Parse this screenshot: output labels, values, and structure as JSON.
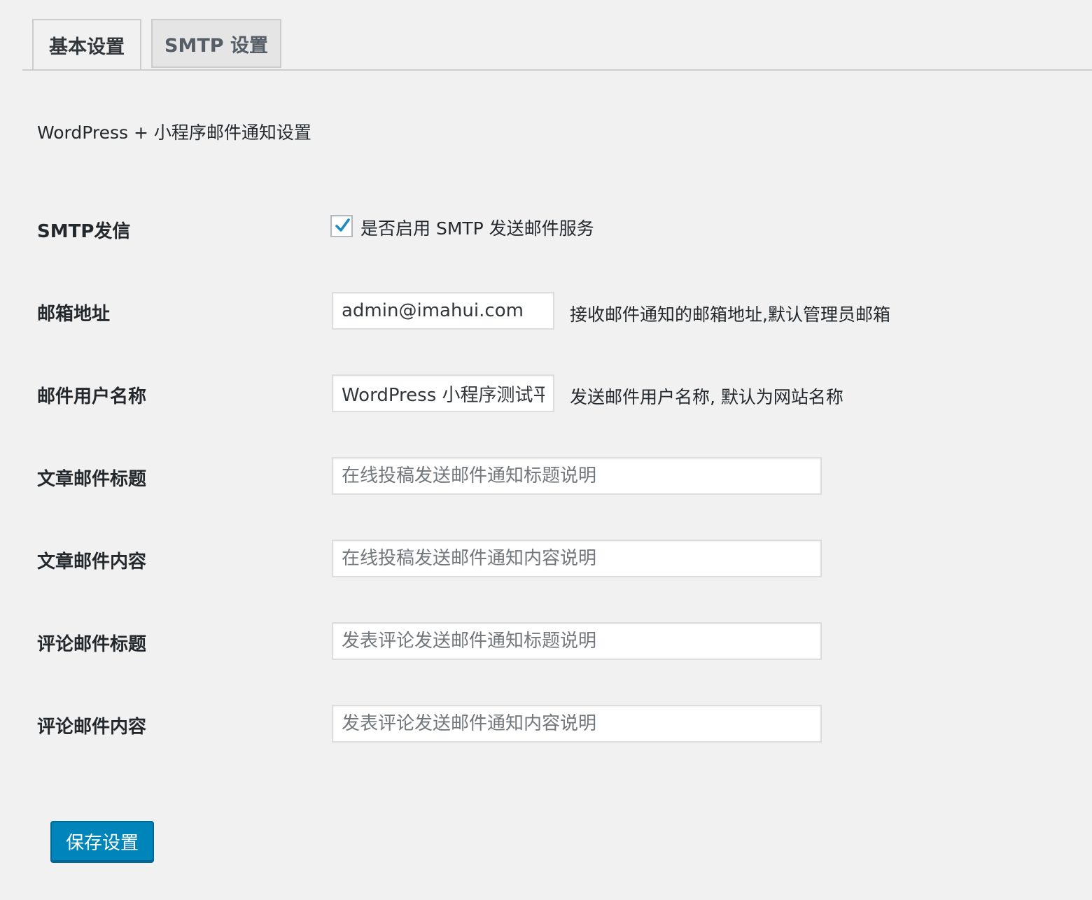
{
  "tabs": [
    {
      "label": "基本设置",
      "active": true
    },
    {
      "label": "SMTP 设置",
      "active": false
    }
  ],
  "section_title": "WordPress + 小程序邮件通知设置",
  "smtp": {
    "label": "SMTP发信",
    "checked": true,
    "checkbox_label": "是否启用 SMTP 发送邮件服务",
    "check_color": "#1e8cbe"
  },
  "fields": [
    {
      "label": "邮箱地址",
      "value": "admin@imahui.com",
      "placeholder": "",
      "description": "接收邮件通知的邮箱地址,默认管理员邮箱"
    },
    {
      "label": "邮件用户名称",
      "value": "WordPress 小程序测试平台",
      "placeholder": "",
      "description": "发送邮件用户名称, 默认为网站名称"
    },
    {
      "label": "文章邮件标题",
      "value": "",
      "placeholder": "在线投稿发送邮件通知标题说明",
      "description": ""
    },
    {
      "label": "文章邮件内容",
      "value": "",
      "placeholder": "在线投稿发送邮件通知内容说明",
      "description": ""
    },
    {
      "label": "评论邮件标题",
      "value": "",
      "placeholder": "发表评论发送邮件通知标题说明",
      "description": ""
    },
    {
      "label": "评论邮件内容",
      "value": "",
      "placeholder": "发表评论发送邮件通知内容说明",
      "description": ""
    }
  ],
  "save_button": "保存设置",
  "colors": {
    "background": "#f1f1f1",
    "primary_button": "#0085ba",
    "checkmark": "#1e8cbe"
  }
}
